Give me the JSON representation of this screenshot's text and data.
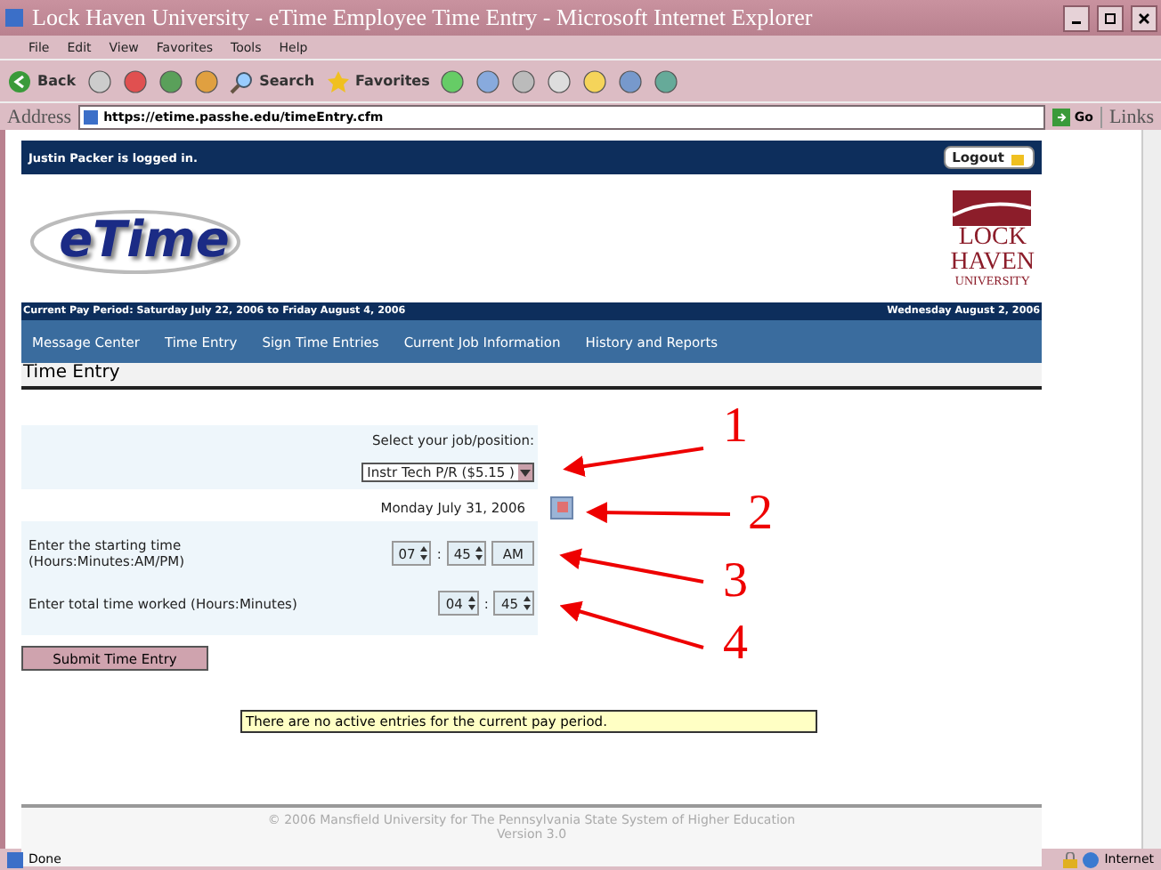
{
  "window": {
    "title": "Lock Haven University - eTime Employee Time Entry - Microsoft Internet Explorer"
  },
  "menu": [
    "File",
    "Edit",
    "View",
    "Favorites",
    "Tools",
    "Help"
  ],
  "toolbar": {
    "back": "Back",
    "search": "Search",
    "favorites": "Favorites"
  },
  "address_bar": {
    "label": "Address",
    "url": "https://etime.passhe.edu/timeEntry.cfm",
    "go": "Go",
    "links": "Links"
  },
  "page": {
    "user_bar": {
      "text": "Justin Packer is logged in.",
      "logout": "Logout"
    },
    "logo": "eTime",
    "university_logo": [
      "LOCK",
      "HAVEN",
      "UNIVERSITY"
    ],
    "pay_period": "Current Pay Period: Saturday July 22, 2006 to Friday August 4, 2006",
    "today": "Wednesday August 2, 2006",
    "nav": [
      "Message Center",
      "Time Entry",
      "Sign Time Entries",
      "Current Job Information",
      "History and Reports"
    ],
    "heading": "Time Entry",
    "form": {
      "job_label": "Select your job/position:",
      "job_value": "Instr Tech P/R ($5.15 )",
      "date": "Monday July 31, 2006",
      "start_label": "Enter the starting time",
      "start_hint": "(Hours:Minutes:AM/PM)",
      "start_hours": "07",
      "start_minutes": "45",
      "start_ampm": "AM",
      "start_separator": ":",
      "total_separator": ":",
      "total_label": "Enter total time worked (Hours:Minutes)",
      "total_hours": "04",
      "total_minutes": "45",
      "submit": "Submit Time Entry"
    },
    "message": "There are no active entries for the current pay period.",
    "footer": [
      "© 2006 Mansfield University for The Pennsylvania State System of Higher Education",
      "Version 3.0"
    ]
  },
  "annotations": [
    "1",
    "2",
    "3",
    "4"
  ],
  "status_bar": {
    "text": "Done",
    "zone": "Internet"
  }
}
